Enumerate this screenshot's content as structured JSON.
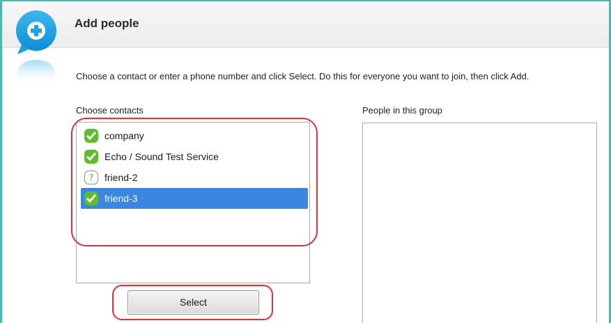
{
  "dialog": {
    "title": "Add people",
    "instructions": "Choose a contact or enter a phone number and click Select. Do this for everyone you want to join, then click Add."
  },
  "contacts_panel": {
    "label": "Choose contacts",
    "items": [
      {
        "name": "company",
        "status_icon": "online-check-icon",
        "selected": false
      },
      {
        "name": "Echo / Sound Test Service",
        "status_icon": "online-check-icon",
        "selected": false
      },
      {
        "name": "friend-2",
        "status_icon": "unknown-status-icon",
        "selected": false
      },
      {
        "name": "friend-3",
        "status_icon": "online-check-icon",
        "selected": true
      }
    ]
  },
  "group_panel": {
    "label": "People in this group",
    "items": []
  },
  "actions": {
    "select_label": "Select"
  },
  "colors": {
    "accent_border": "#4ab8b0",
    "selection": "#3b86e0",
    "annotation_red": "#e0303c",
    "status_green": "#5cbf2a"
  }
}
